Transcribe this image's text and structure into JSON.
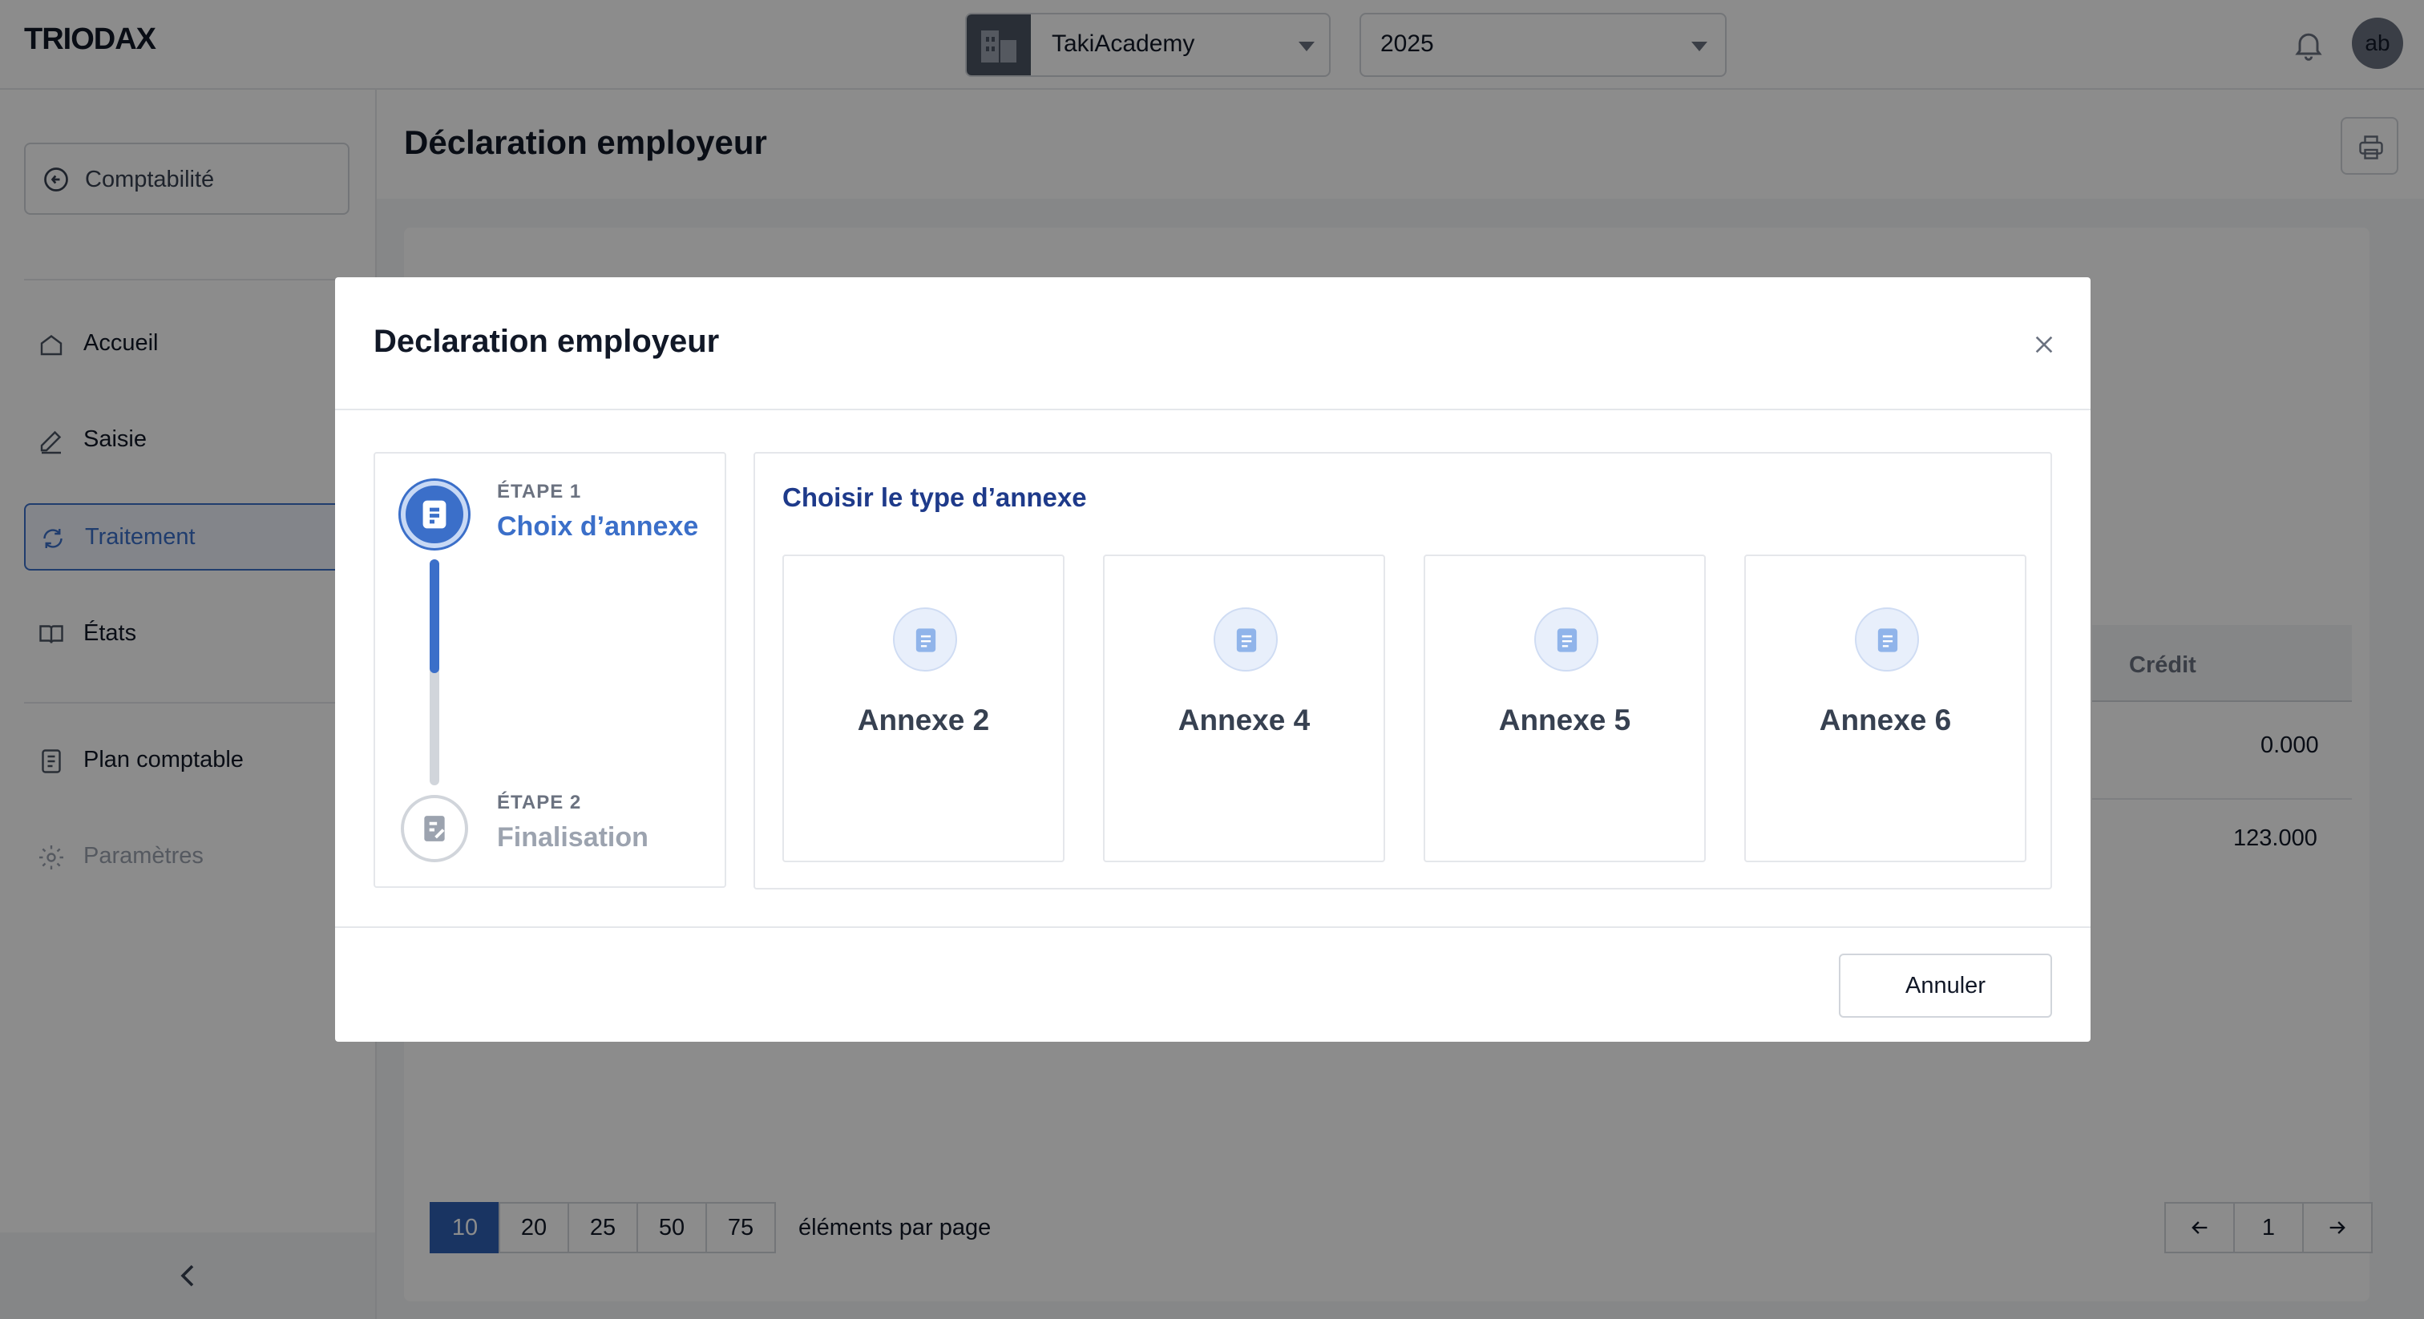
{
  "app": {
    "logo": "TRIODAX"
  },
  "topbar": {
    "company": "TakiAcademy",
    "year": "2025",
    "avatar_initials": "ab"
  },
  "sidebar": {
    "back_label": "Comptabilité",
    "items": [
      {
        "label": "Accueil"
      },
      {
        "label": "Saisie"
      },
      {
        "label": "Traitement"
      },
      {
        "label": "États"
      },
      {
        "label": "Plan comptable"
      },
      {
        "label": "Paramètres"
      }
    ]
  },
  "page": {
    "title": "Déclaration employeur"
  },
  "table_bg": {
    "header_credit": "Crédit",
    "rows": [
      "0.000",
      "123.000"
    ]
  },
  "pagination": {
    "sizes": [
      "10",
      "20",
      "25",
      "50",
      "75"
    ],
    "per_page_label": "éléments par page",
    "current_page": "1"
  },
  "modal": {
    "title": "Declaration employeur",
    "steps": [
      {
        "label": "ÉTAPE 1",
        "name": "Choix d’annexe"
      },
      {
        "label": "ÉTAPE 2",
        "name": "Finalisation"
      }
    ],
    "panel_title": "Choisir le type d’annexe",
    "annexes": [
      "Annexe 2",
      "Annexe 4",
      "Annexe 5",
      "Annexe 6"
    ],
    "cancel_label": "Annuler"
  },
  "colors": {
    "accent": "#3b6fc9",
    "overlay": "rgba(0,0,0,0.45)"
  }
}
